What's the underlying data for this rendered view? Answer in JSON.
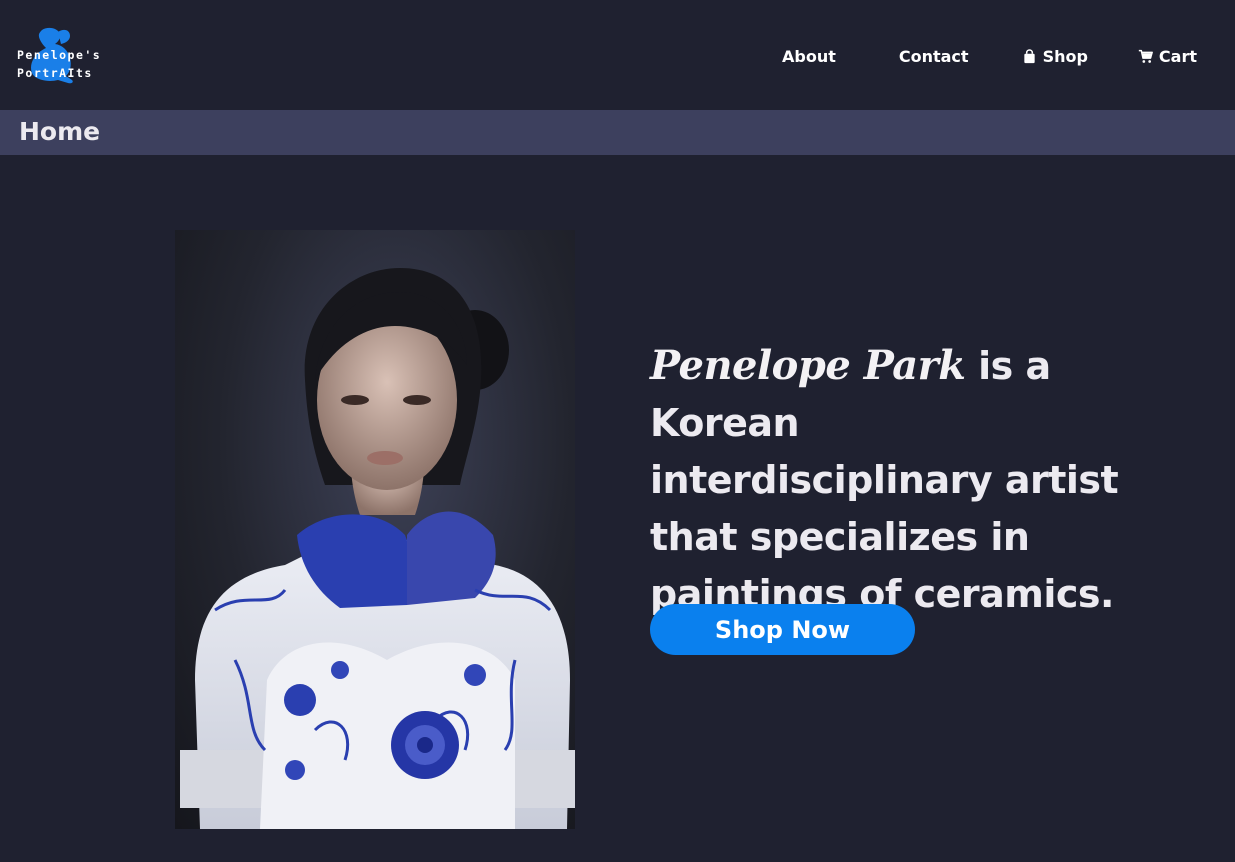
{
  "header": {
    "logo_line1": "Penelope's",
    "logo_line2": "PortrAIts",
    "logo_icon": "rabbit-icon",
    "nav": {
      "about": "About",
      "contact": "Contact",
      "shop": "Shop",
      "shop_icon": "shopping-bag-icon",
      "cart": "Cart",
      "cart_icon": "shopping-cart-icon"
    }
  },
  "breadcrumb": {
    "title": "Home"
  },
  "hero": {
    "portrait_alt": "portrait-image",
    "name": "Penelope Park",
    "description": " is a Korean interdisciplinary artist that specializes in paintings of ceramics.",
    "cta_label": "Shop Now"
  },
  "colors": {
    "background": "#1f2130",
    "breadcrumb_bar": "#3d405e",
    "accent": "#0a80ee",
    "logo_blue": "#1a7fe8",
    "porcelain_blue": "#2a3fb0"
  }
}
